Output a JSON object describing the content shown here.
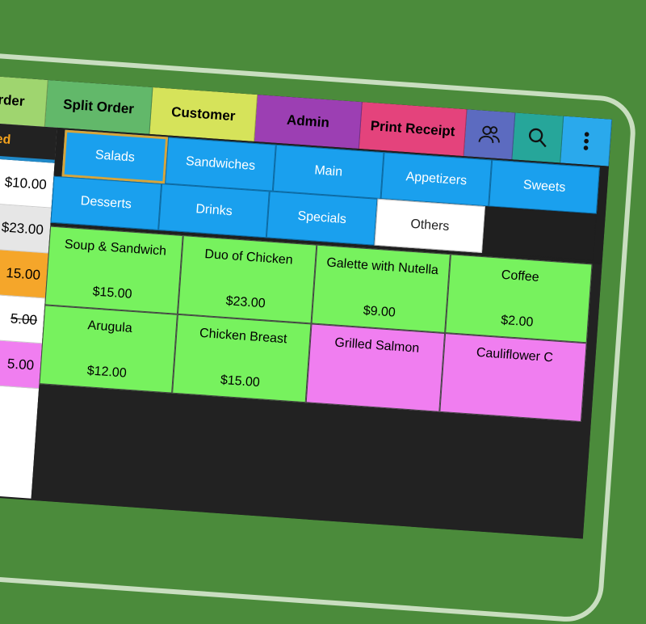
{
  "toolbar": {
    "order_label": "Order",
    "split_order_label": "Split Order",
    "customer_label": "Customer",
    "admin_label": "Admin",
    "print_receipt_label": "Print Receipt",
    "icons": [
      "people-icon",
      "search-icon",
      "more-vert-icon"
    ]
  },
  "order_panel": {
    "header": "red",
    "rows": [
      "$10.00",
      "$23.00",
      "15.00",
      "5.00",
      "5.00"
    ]
  },
  "categories": [
    "Salads",
    "Sandwiches",
    "Main",
    "Appetizers",
    "Sweets",
    "Desserts",
    "Drinks",
    "Specials",
    "Others"
  ],
  "menu_items": [
    {
      "name": "Soup & Sandwich",
      "price": "$15.00"
    },
    {
      "name": "Duo of Chicken",
      "price": "$23.00"
    },
    {
      "name": "Galette with Nutella",
      "price": "$9.00"
    },
    {
      "name": "Coffee",
      "price": "$2.00"
    },
    {
      "name": "Arugula",
      "price": "$12.00"
    },
    {
      "name": "Chicken Breast",
      "price": "$15.00"
    },
    {
      "name": "Grilled Salmon",
      "price": ""
    },
    {
      "name": "Cauliflower C",
      "price": ""
    }
  ],
  "colors": {
    "background": "#4b8b3b",
    "order_btn": "#9fd56f",
    "split_order_btn": "#62b86a",
    "customer_btn": "#d6e35a",
    "admin_btn": "#9c3fb3",
    "print_receipt_btn": "#e4437c",
    "people_btn": "#5c6bc0",
    "search_btn": "#26a69a",
    "more_btn": "#2aa9ec",
    "category": "#1aa0ee",
    "item_green": "#77f25e",
    "item_pink": "#f07ef0"
  }
}
